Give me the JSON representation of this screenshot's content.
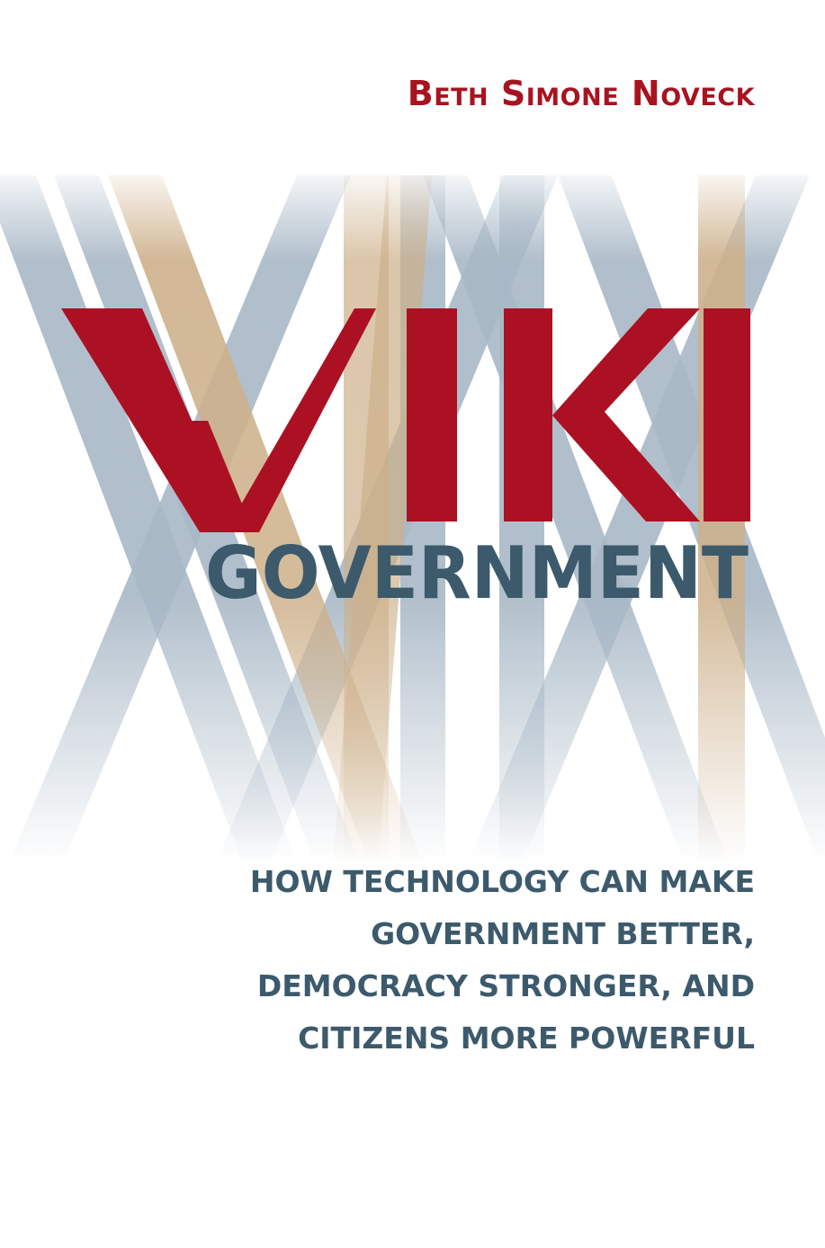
{
  "cover": {
    "author": "Beth Simone Noveck",
    "title_main": "WIKI",
    "title_sub": "GOVERNMENT",
    "subtitle_lines": [
      "HOW TECHNOLOGY CAN MAKE",
      "GOVERNMENT BETTER,",
      "DEMOCRACY STRONGER, AND",
      "CITIZENS MORE POWERFUL"
    ]
  },
  "colors": {
    "red": "#ab1123",
    "slate": "#3c5a6c",
    "steel_stripe": "#a8b8c6",
    "tan_stripe": "#cdb08a",
    "background": "#ffffff"
  }
}
